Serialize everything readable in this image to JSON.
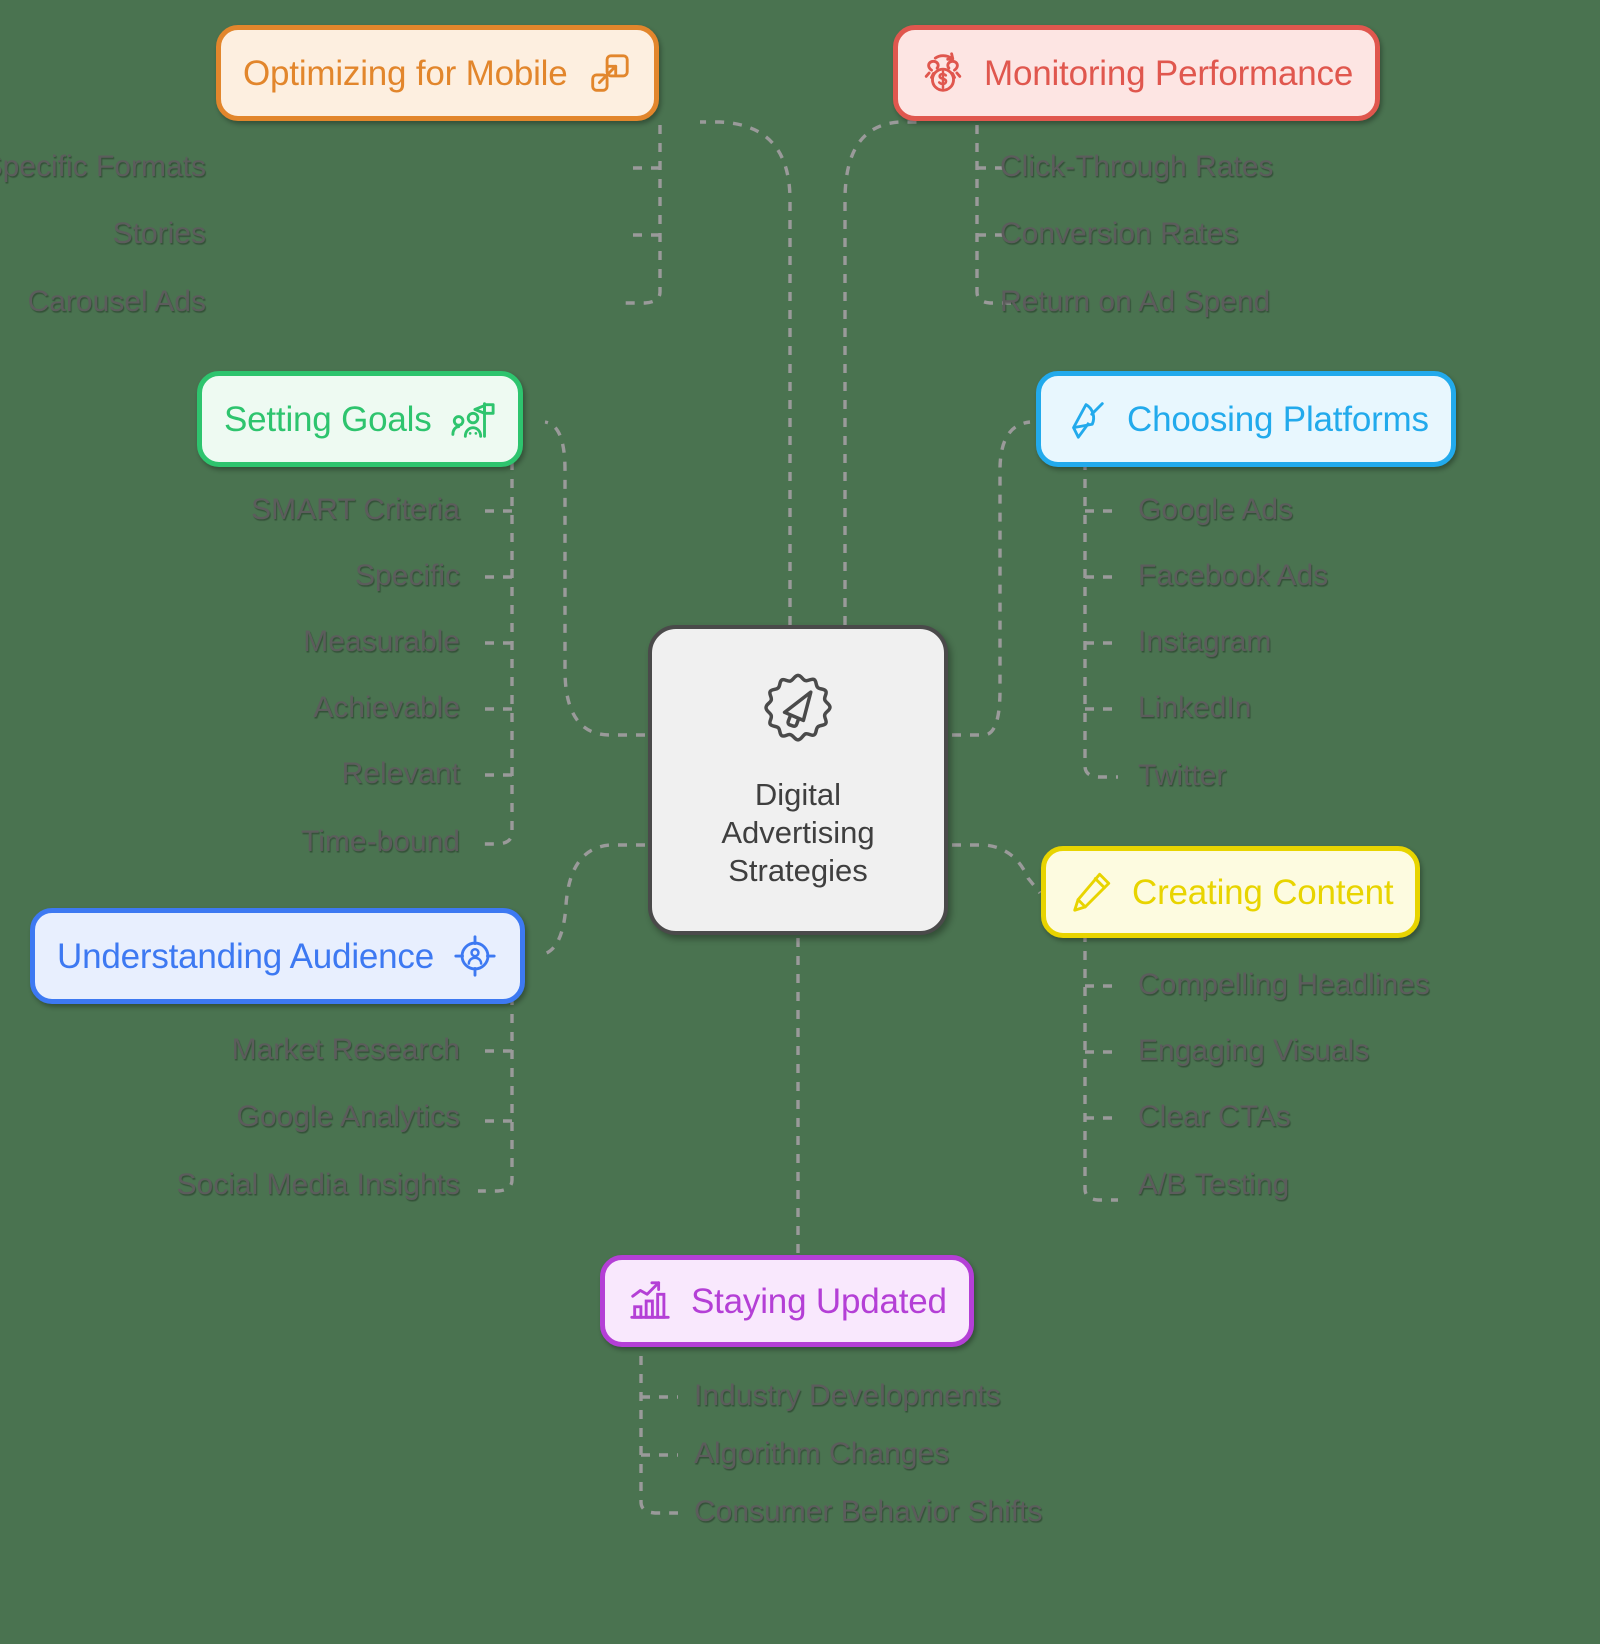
{
  "background_color": "#4a7350",
  "central": {
    "title": "Digital Advertising Strategies",
    "title_lines": [
      "Digital",
      "Advertising",
      "Strategies"
    ],
    "icon": "megaphone-badge-icon",
    "color": "#4a4a4a",
    "fill": "#f0f0f0"
  },
  "branches": [
    {
      "id": "optimizing-for-mobile",
      "label": "Optimizing for Mobile",
      "icon": "mobile-responsive-icon",
      "icon_side": "right",
      "color": "#e2862c",
      "fill": "#fdefe0",
      "children": [
        "Mobile-Specific Formats",
        "Stories",
        "Carousel Ads"
      ]
    },
    {
      "id": "monitoring-performance",
      "label": "Monitoring Performance",
      "icon": "return-on-investment-icon",
      "icon_side": "left",
      "color": "#e0574e",
      "fill": "#fde5e3",
      "children": [
        "Click-Through Rates",
        "Conversion Rates",
        "Return on Ad Spend"
      ]
    },
    {
      "id": "setting-goals",
      "label": "Setting Goals",
      "icon": "goal-flag-team-icon",
      "icon_side": "right",
      "color": "#2ec46e",
      "fill": "#eefaf2",
      "children": [
        "SMART Criteria",
        "Specific",
        "Measurable",
        "Achievable",
        "Relevant",
        "Time-bound"
      ]
    },
    {
      "id": "choosing-platforms",
      "label": "Choosing Platforms",
      "icon": "satellite-dish-icon",
      "icon_side": "left",
      "color": "#22aaec",
      "fill": "#e8f7fe",
      "children": [
        "Google Ads",
        "Facebook Ads",
        "Instagram",
        "LinkedIn",
        "Twitter"
      ]
    },
    {
      "id": "understanding-audience",
      "label": "Understanding Audience",
      "icon": "audience-target-icon",
      "icon_side": "right",
      "color": "#3d79f2",
      "fill": "#e8effe",
      "children": [
        "Market Research",
        "Google Analytics",
        "Social Media Insights"
      ]
    },
    {
      "id": "creating-content",
      "label": "Creating Content",
      "icon": "pencil-icon",
      "icon_side": "left",
      "color": "#e8d400",
      "fill": "#fdfbe0",
      "children": [
        "Compelling Headlines",
        "Engaging Visuals",
        "Clear CTAs",
        "A/B Testing"
      ]
    },
    {
      "id": "staying-updated",
      "label": "Staying Updated",
      "icon": "growth-chart-icon",
      "icon_side": "left",
      "color": "#b43fd6",
      "fill": "#f9e8fd",
      "children": [
        "Industry Developments",
        "Algorithm Changes",
        "Consumer Behavior Shifts"
      ]
    }
  ]
}
